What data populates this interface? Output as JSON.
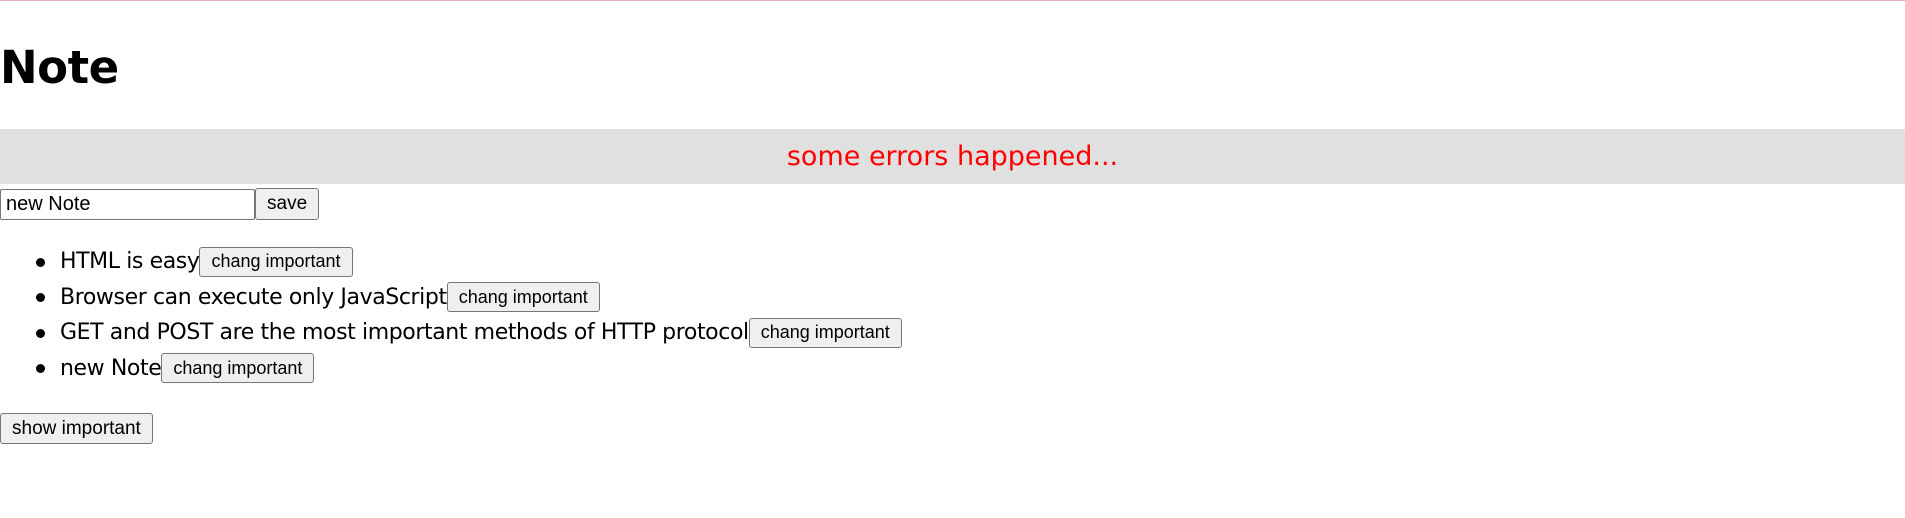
{
  "colors": {
    "top_line": "#e8b4c0",
    "banner_background": "#e1e0e1",
    "error_text": "#ff0000"
  },
  "page": {
    "title": "Note"
  },
  "error": {
    "message": "some errors happened..."
  },
  "form": {
    "input_value": "new Note",
    "save_label": "save"
  },
  "notes": [
    {
      "text": "HTML is easy",
      "button_label": "chang important"
    },
    {
      "text": "Browser can execute only JavaScript",
      "button_label": "chang important"
    },
    {
      "text": "GET and POST are the most important methods of HTTP protocol",
      "button_label": "chang important"
    },
    {
      "text": "new Note",
      "button_label": "chang important"
    }
  ],
  "footer": {
    "show_important_label": "show important"
  }
}
